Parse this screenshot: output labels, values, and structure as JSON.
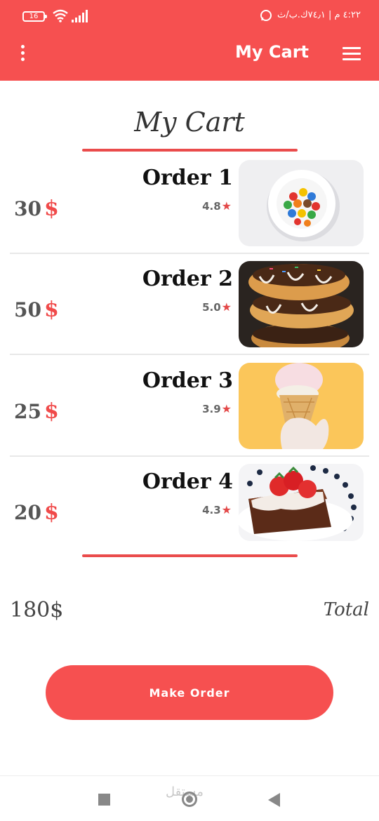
{
  "status_bar": {
    "battery": "16",
    "right_text": "٤:٢٢ م | ٧٤٫١ك.ب/ث",
    "icons": [
      "battery-icon",
      "wifi-icon",
      "signal-icon",
      "whatsapp-icon"
    ]
  },
  "app_bar": {
    "title": "My Cart",
    "icons": [
      "more-vertical-icon",
      "hamburger-menu-icon"
    ]
  },
  "page": {
    "heading": "My Cart"
  },
  "orders": [
    {
      "name": "Order 1",
      "rating": "4.8",
      "price": "30",
      "currency": "$",
      "image": "candy-plate"
    },
    {
      "name": "Order 2",
      "rating": "5.0",
      "price": "50",
      "currency": "$",
      "image": "donut-stack"
    },
    {
      "name": "Order 3",
      "rating": "3.9",
      "price": "25",
      "currency": "$",
      "image": "ice-cream-cone"
    },
    {
      "name": "Order 4",
      "rating": "4.3",
      "price": "20",
      "currency": "$",
      "image": "brownie-strawberry"
    }
  ],
  "total": {
    "value": "180$",
    "label": "Total"
  },
  "actions": {
    "make_order": "Make Order"
  },
  "nav": {
    "icons": [
      "recent-apps-icon",
      "home-icon",
      "back-icon"
    ],
    "watermark": "مستقل"
  },
  "colors": {
    "accent": "#f65050",
    "star": "#e34848"
  }
}
